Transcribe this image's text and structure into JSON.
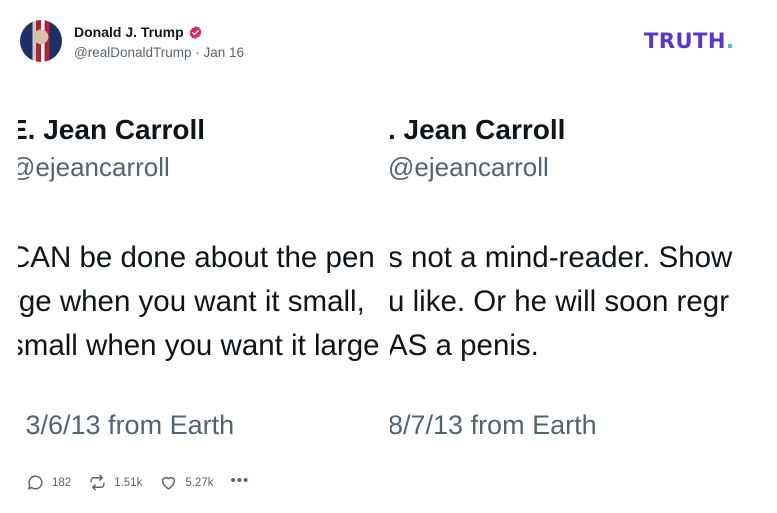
{
  "post": {
    "author_name": "Donald J. Trump",
    "handle": "@realDonaldTrump",
    "separator": "·",
    "date": "Jan 16"
  },
  "brand": {
    "logo_text": "TRUTH",
    "logo_dot": ".",
    "logo_color": "#5a35d6",
    "dot_color": "#1fd1b0"
  },
  "screenshot": {
    "left": {
      "name": "E. Jean Carroll",
      "handle": "@ejeancarroll",
      "lines": [
        "CAN be done about the pen",
        "rge when you want it small,",
        "small when you want it large"
      ],
      "date": "· 3/6/13 from Earth"
    },
    "right": {
      "name": ". Jean Carroll",
      "handle": "@ejeancarroll",
      "lines": [
        "s not a mind-reader. Show",
        "u like. Or he will soon regr",
        "AS a penis."
      ],
      "date": "8/7/13 from Earth"
    }
  },
  "actions": {
    "replies": "182",
    "retruths": "1.51k",
    "likes": "5.27k",
    "more": "•••"
  },
  "icons": {
    "verified": "verified-badge-icon",
    "reply": "reply-bubble-icon",
    "retruth": "retruth-icon",
    "like": "heart-icon",
    "more": "more-dots-icon"
  }
}
